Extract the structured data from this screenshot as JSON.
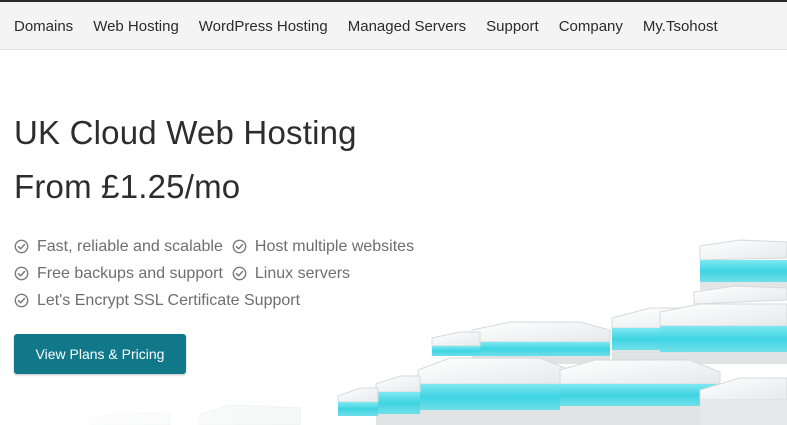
{
  "nav": {
    "items": [
      "Domains",
      "Web Hosting",
      "WordPress Hosting",
      "Managed Servers",
      "Support",
      "Company",
      "My.Tsohost"
    ]
  },
  "hero": {
    "title": "UK Cloud Web Hosting",
    "price": "From £1.25/mo",
    "features": [
      [
        "Fast, reliable and scalable",
        "Host multiple websites"
      ],
      [
        "Free backups and support",
        "Linux servers"
      ],
      [
        "Let's Encrypt SSL Certificate Support"
      ]
    ],
    "cta_label": "View Plans & Pricing"
  },
  "colors": {
    "accent": "#11788a",
    "server_glow": "#45d9e6"
  },
  "icons": {
    "feature_check": "check-circle-icon"
  }
}
